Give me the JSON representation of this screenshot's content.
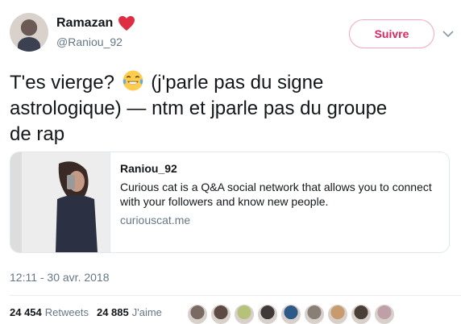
{
  "tweet": {
    "author_name": "Ramazan",
    "author_handle": "@Raniou_92",
    "follow_label": "Suivre",
    "text_line1_pre": "T'es vierge? ",
    "text_line1_post": " (j'parle pas du signe",
    "text_line2": "astrologique) — ntm et jparle pas du groupe",
    "text_line3": "de rap",
    "timestamp": "12:11 - 30 avr. 2018"
  },
  "card": {
    "title": "Raniou_92",
    "description": "Curious cat is a Q&A social network that allows you to connect with your followers and know new people.",
    "domain": "curiouscat.me"
  },
  "stats": {
    "retweets_count": "24 454",
    "retweets_label": "Retweets",
    "likes_count": "24 885",
    "likes_label": "J'aime"
  },
  "icons": {
    "heart": "red-heart-emoji",
    "emoji": "face-with-tears-of-joy",
    "chevron": "chevron-down-icon"
  },
  "colors": {
    "accent_pink": "#e0245e",
    "text_secondary": "#657786",
    "border": "#e1e8ed"
  },
  "liker_colors": [
    "#7a6a64",
    "#5d4a44",
    "#b6c27a",
    "#3f3a38",
    "#2e5a88",
    "#8a7f76",
    "#c79b6e",
    "#4a4038",
    "#c0a0a8"
  ]
}
